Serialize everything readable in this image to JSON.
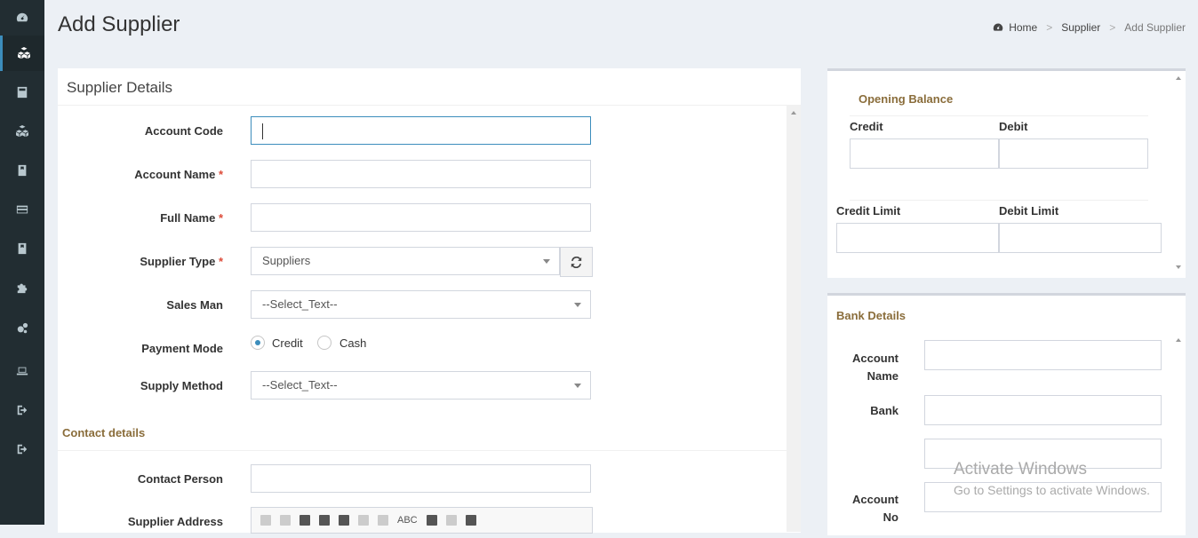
{
  "page": {
    "title": "Add Supplier"
  },
  "breadcrumb": {
    "home": "Home",
    "parent": "Supplier",
    "current": "Add Supplier"
  },
  "sidebar": {
    "icons": [
      "dashboard-icon",
      "cubes-icon",
      "calculator-icon",
      "cubes-icon-2",
      "book-icon",
      "credit-card-icon",
      "book-icon-2",
      "puzzle-icon",
      "gears-icon",
      "laptop-icon",
      "sign-out-icon",
      "sign-out-icon-2"
    ]
  },
  "supplier_details": {
    "title": "Supplier Details",
    "account_code_label": "Account Code",
    "account_name_label": "Account Name",
    "full_name_label": "Full Name",
    "supplier_type_label": "Supplier Type",
    "supplier_type_value": "Suppliers",
    "sales_man_label": "Sales Man",
    "sales_man_value": "--Select_Text--",
    "payment_mode_label": "Payment Mode",
    "payment_credit": "Credit",
    "payment_cash": "Cash",
    "supply_method_label": "Supply Method",
    "supply_method_value": "--Select_Text--",
    "required_mark": "*"
  },
  "contact": {
    "title": "Contact details",
    "contact_person_label": "Contact Person",
    "address_label": "Supplier Address",
    "toolbar_abc": "ABC"
  },
  "opening_balance": {
    "title": "Opening Balance",
    "credit_label": "Credit",
    "debit_label": "Debit",
    "credit_limit_label": "Credit Limit",
    "debit_limit_label": "Debit Limit"
  },
  "bank_details": {
    "title": "Bank Details",
    "account_name_label_1": "Account",
    "account_name_label_2": "Name",
    "bank_label": "Bank",
    "account_no_label_1": "Account",
    "account_no_label_2": "No"
  },
  "watermark": {
    "line1": "Activate Windows",
    "line2": "Go to Settings to activate Windows."
  },
  "colors": {
    "accent": "#3c8dbc",
    "section": "#8a6d3b",
    "required": "#dd4b39",
    "sidebar": "#222d32"
  }
}
